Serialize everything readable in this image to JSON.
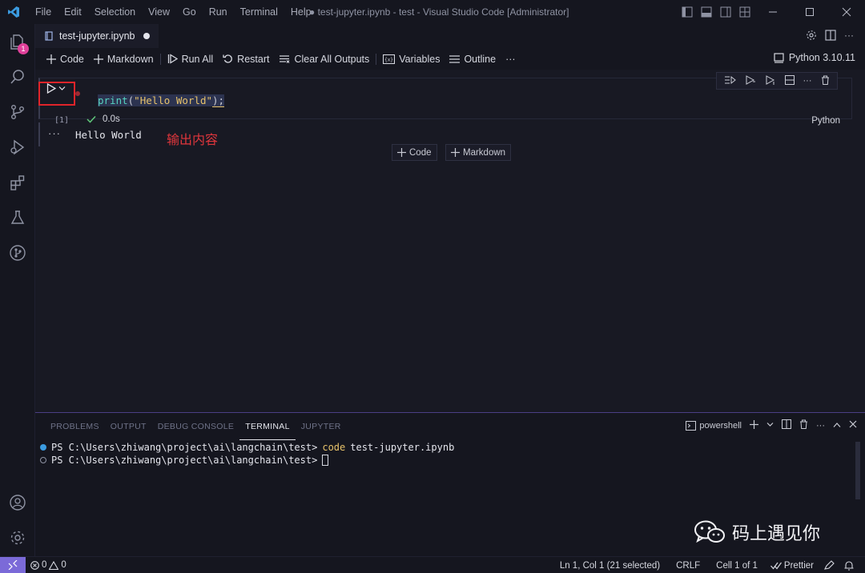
{
  "window": {
    "menu": [
      "File",
      "Edit",
      "Selection",
      "View",
      "Go",
      "Run",
      "Terminal",
      "Help"
    ],
    "title": "● test-jupyter.ipynb - test - Visual Studio Code [Administrator]"
  },
  "activity": {
    "explorer_badge": "1"
  },
  "tab": {
    "name": "test-jupyter.ipynb"
  },
  "toolbar": {
    "code": "Code",
    "markdown": "Markdown",
    "run_all": "Run All",
    "restart": "Restart",
    "clear_all": "Clear All Outputs",
    "variables": "Variables",
    "outline": "Outline",
    "more": "···",
    "kernel": "Python 3.10.11"
  },
  "cell": {
    "code_fn": "print",
    "code_open": "(",
    "code_str": "\"Hello World\"",
    "code_close": ");",
    "exec_count": "[1]",
    "duration": "0.0s",
    "language": "Python"
  },
  "output": {
    "more": "···",
    "text": "Hello World",
    "annotation": "输出内容"
  },
  "add_cell": {
    "code": "Code",
    "markdown": "Markdown"
  },
  "panel": {
    "tabs": [
      "PROBLEMS",
      "OUTPUT",
      "DEBUG CONSOLE",
      "TERMINAL",
      "JUPYTER"
    ],
    "shell": "powershell",
    "lines": [
      {
        "prompt": "PS C:\\Users\\zhiwang\\project\\ai\\langchain\\test>",
        "cmd": "code",
        "arg": "test-jupyter.ipynb"
      },
      {
        "prompt": "PS C:\\Users\\zhiwang\\project\\ai\\langchain\\test>",
        "cmd": "",
        "arg": ""
      }
    ]
  },
  "watermark": "码上遇见你",
  "status": {
    "errors": "0",
    "warnings": "0",
    "position": "Ln 1, Col 1 (21 selected)",
    "eol": "CRLF",
    "cell": "Cell 1 of 1",
    "prettier": "Prettier"
  },
  "colors": {
    "accent": "#7b6ad8",
    "annotation": "#e0363c",
    "badge": "#e0409a"
  }
}
